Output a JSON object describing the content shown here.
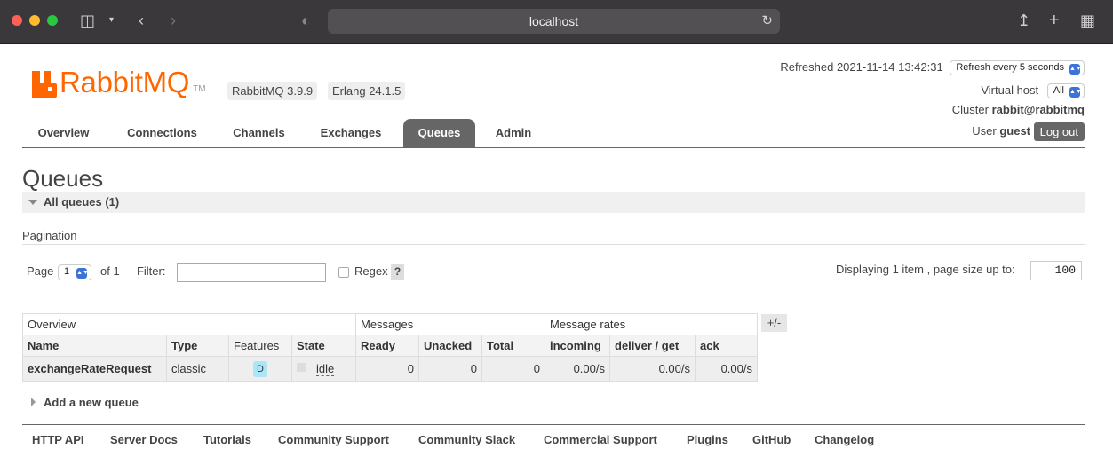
{
  "browser": {
    "url": "localhost"
  },
  "header": {
    "logo_text": "RabbitMQ",
    "logo_tm": "TM",
    "version_rabbit": "RabbitMQ 3.9.9",
    "version_erlang": "Erlang 24.1.5",
    "refreshed_label": "Refreshed",
    "refreshed_time": "2021-11-14 13:42:31",
    "refresh_select": "Refresh every 5 seconds",
    "vhost_label": "Virtual host",
    "vhost_select": "All",
    "cluster_label": "Cluster",
    "cluster_name": "rabbit@rabbitmq",
    "user_label": "User",
    "user_name": "guest",
    "logout": "Log out"
  },
  "tabs": [
    "Overview",
    "Connections",
    "Channels",
    "Exchanges",
    "Queues",
    "Admin"
  ],
  "active_tab": "Queues",
  "page": {
    "title": "Queues",
    "section": "All queues (1)"
  },
  "pagination": {
    "label": "Pagination",
    "page_label": "Page",
    "page_value": "1",
    "of_label": "of 1",
    "filter_label": "- Filter:",
    "filter_value": "",
    "regex_label": "Regex",
    "help": "?",
    "displaying": "Displaying 1 item , page size up to:",
    "page_size": "100"
  },
  "table": {
    "groups": [
      "Overview",
      "Messages",
      "Message rates"
    ],
    "columns": [
      "Name",
      "Type",
      "Features",
      "State",
      "Ready",
      "Unacked",
      "Total",
      "incoming",
      "deliver / get",
      "ack"
    ],
    "toggle": "+/-",
    "rows": [
      {
        "name": "exchangeRateRequest",
        "type": "classic",
        "features": "D",
        "state": "idle",
        "ready": "0",
        "unacked": "0",
        "total": "0",
        "incoming": "0.00/s",
        "deliver_get": "0.00/s",
        "ack": "0.00/s"
      }
    ]
  },
  "add_queue": "Add a new queue",
  "footer": [
    "HTTP API",
    "Server Docs",
    "Tutorials",
    "Community Support",
    "Community Slack",
    "Commercial Support",
    "Plugins",
    "GitHub",
    "Changelog"
  ],
  "colors": {
    "brand_orange": "#ff6600",
    "tab_active": "#666666",
    "durable_badge": "#abe5f7"
  }
}
